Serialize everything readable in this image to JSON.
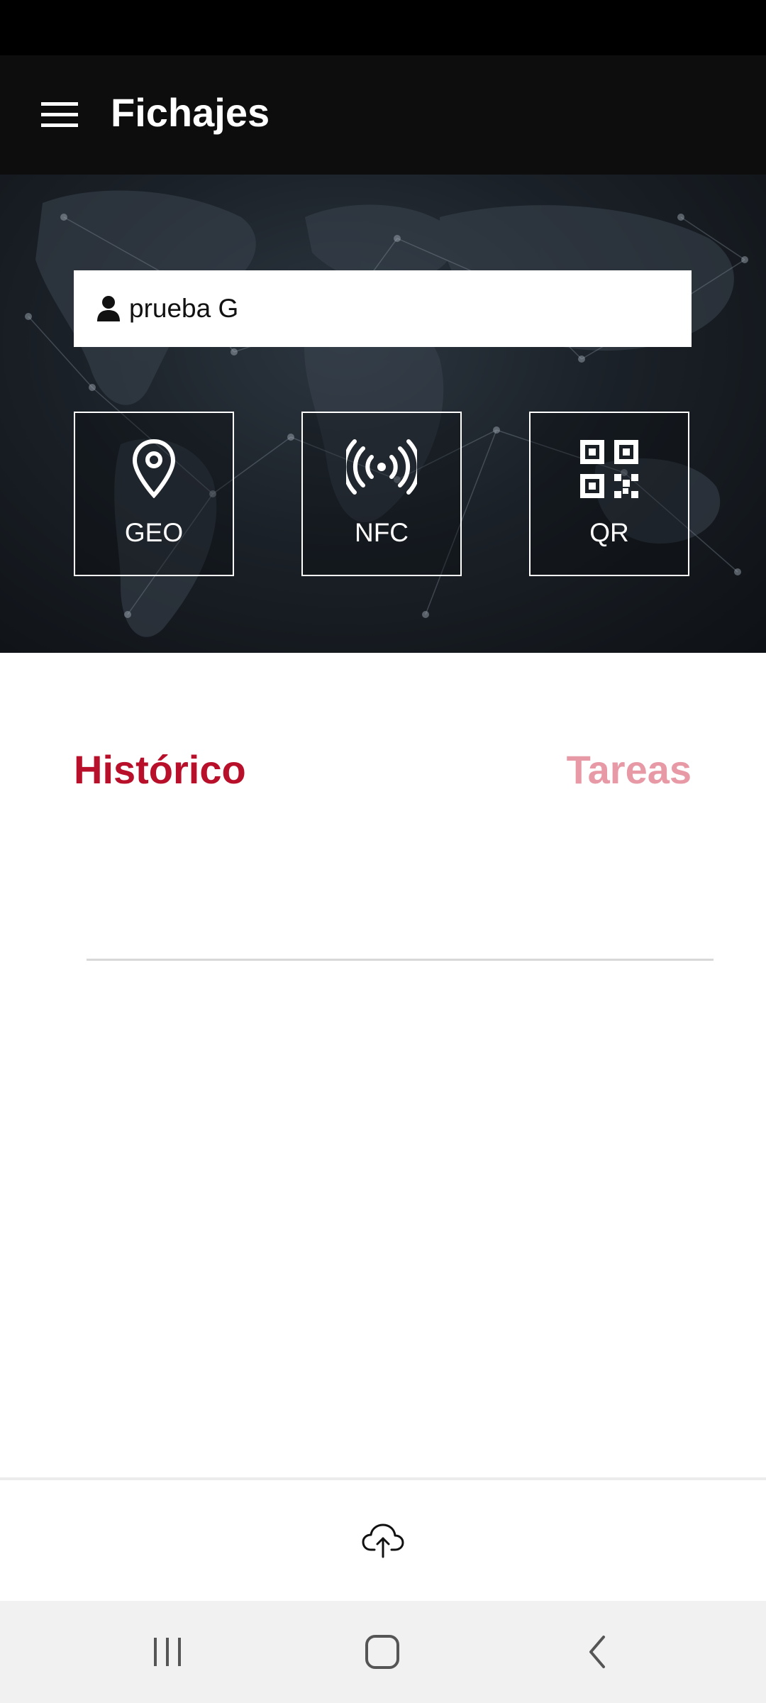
{
  "app_bar": {
    "title": "Fichajes",
    "menu_icon": "hamburger-menu-icon"
  },
  "user": {
    "name": "prueba G",
    "icon": "person-icon"
  },
  "methods": [
    {
      "label": "GEO",
      "icon": "location-pin-icon"
    },
    {
      "label": "NFC",
      "icon": "nfc-signal-icon"
    },
    {
      "label": "QR",
      "icon": "qr-code-icon"
    }
  ],
  "tabs": {
    "historico": "Histórico",
    "tareas": "Tareas"
  },
  "bottom": {
    "upload_icon": "cloud-upload-icon"
  },
  "system_nav": {
    "recents_icon": "recents-icon",
    "home_icon": "home-icon",
    "back_icon": "back-icon"
  },
  "colors": {
    "accent_active": "#b8102a",
    "accent_inactive": "#e79aa6",
    "app_bar": "#0d0d0d"
  }
}
